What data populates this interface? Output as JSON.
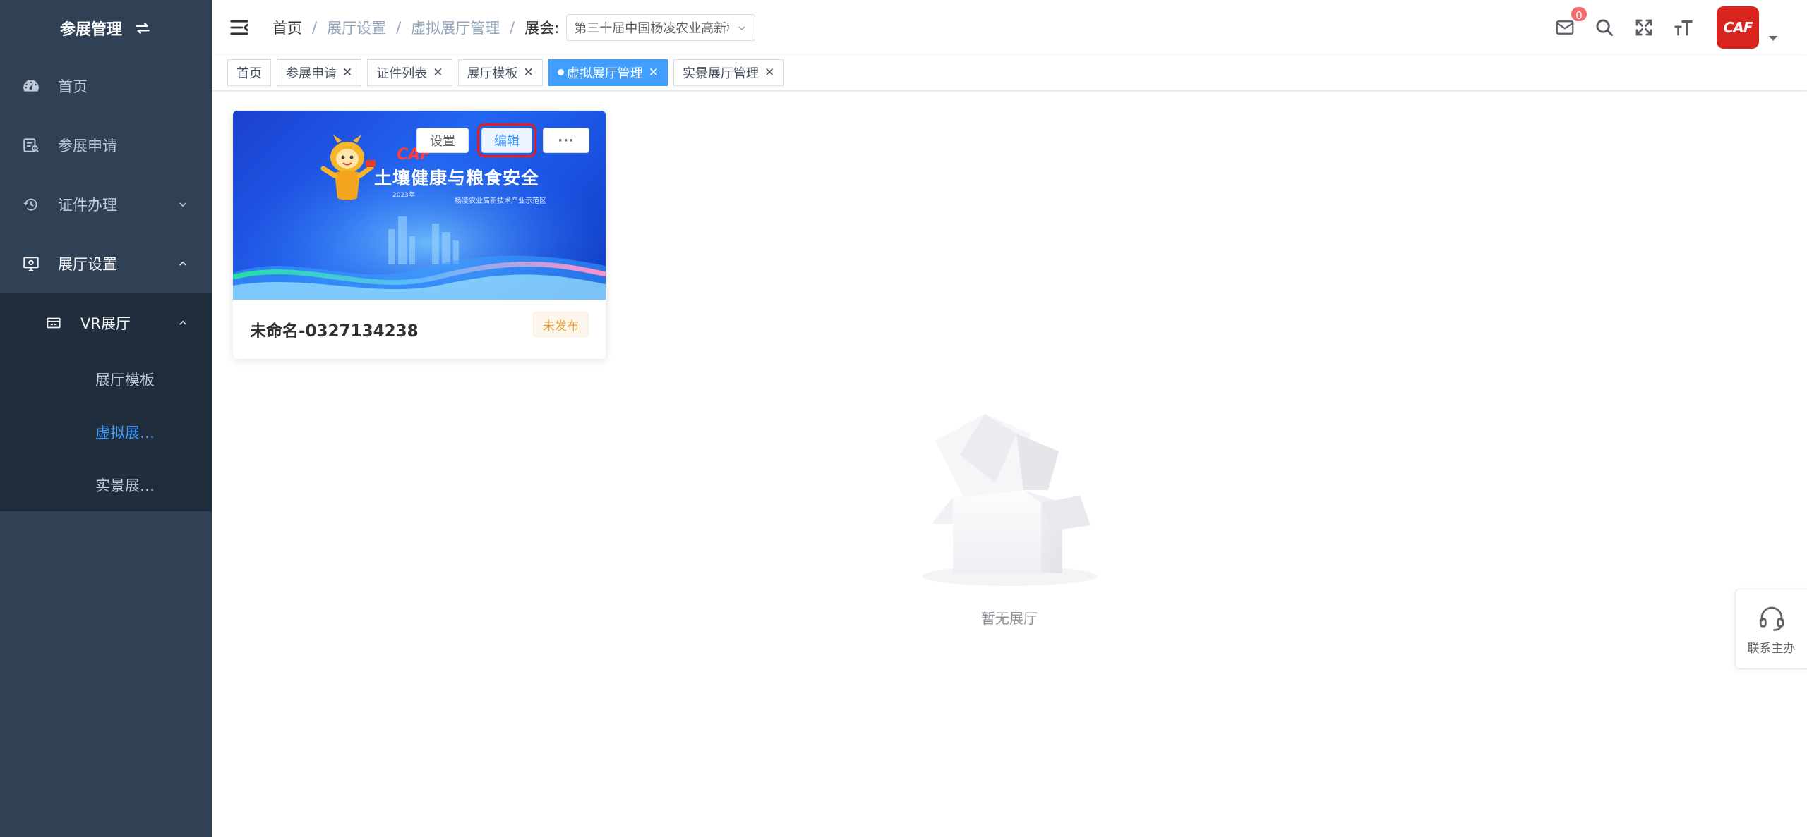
{
  "sidebar": {
    "title": "参展管理",
    "title_icon": "switch-icon",
    "items": [
      {
        "label": "首页",
        "icon": "dashboard-icon"
      },
      {
        "label": "参展申请",
        "icon": "apply-icon"
      },
      {
        "label": "证件办理",
        "icon": "certificate-icon"
      },
      {
        "label": "展厅设置",
        "icon": "monitor-icon"
      }
    ],
    "submenu": {
      "label": "VR展厅",
      "icon": "vr-icon",
      "items": [
        {
          "label": "展厅模板"
        },
        {
          "label": "虚拟展…",
          "active": true
        },
        {
          "label": "实景展…"
        }
      ]
    }
  },
  "navbar": {
    "breadcrumb": [
      "首页",
      "展厅设置",
      "虚拟展厅管理"
    ],
    "expo_label": "展会:",
    "expo_value": "第三十届中国杨凌农业高新科技成果博览会",
    "message_count": "0",
    "avatar_text": "CAF"
  },
  "tags": [
    {
      "label": "首页",
      "closable": false
    },
    {
      "label": "参展申请",
      "closable": true
    },
    {
      "label": "证件列表",
      "closable": true
    },
    {
      "label": "展厅模板",
      "closable": true
    },
    {
      "label": "虚拟展厅管理",
      "closable": true,
      "active": true
    },
    {
      "label": "实景展厅管理",
      "closable": true
    }
  ],
  "card": {
    "cover": {
      "logo": "CAF",
      "title": "土壤健康与粮食安全",
      "year": "2023年",
      "subtitle": "杨凌农业高新技术产业示范区"
    },
    "buttons": {
      "settings": "设置",
      "edit": "编辑",
      "more": "···"
    },
    "name": "未命名-0327134238",
    "status": "未发布"
  },
  "empty": {
    "text": "暂无展厅"
  },
  "contact": {
    "label": "联系主办"
  },
  "colors": {
    "sidebar": "#304156",
    "sidebar_sub": "#1f2d3d",
    "primary": "#409eff",
    "warning": "#e6a23c",
    "danger": "#f56c6c",
    "highlight": "#e02020"
  }
}
